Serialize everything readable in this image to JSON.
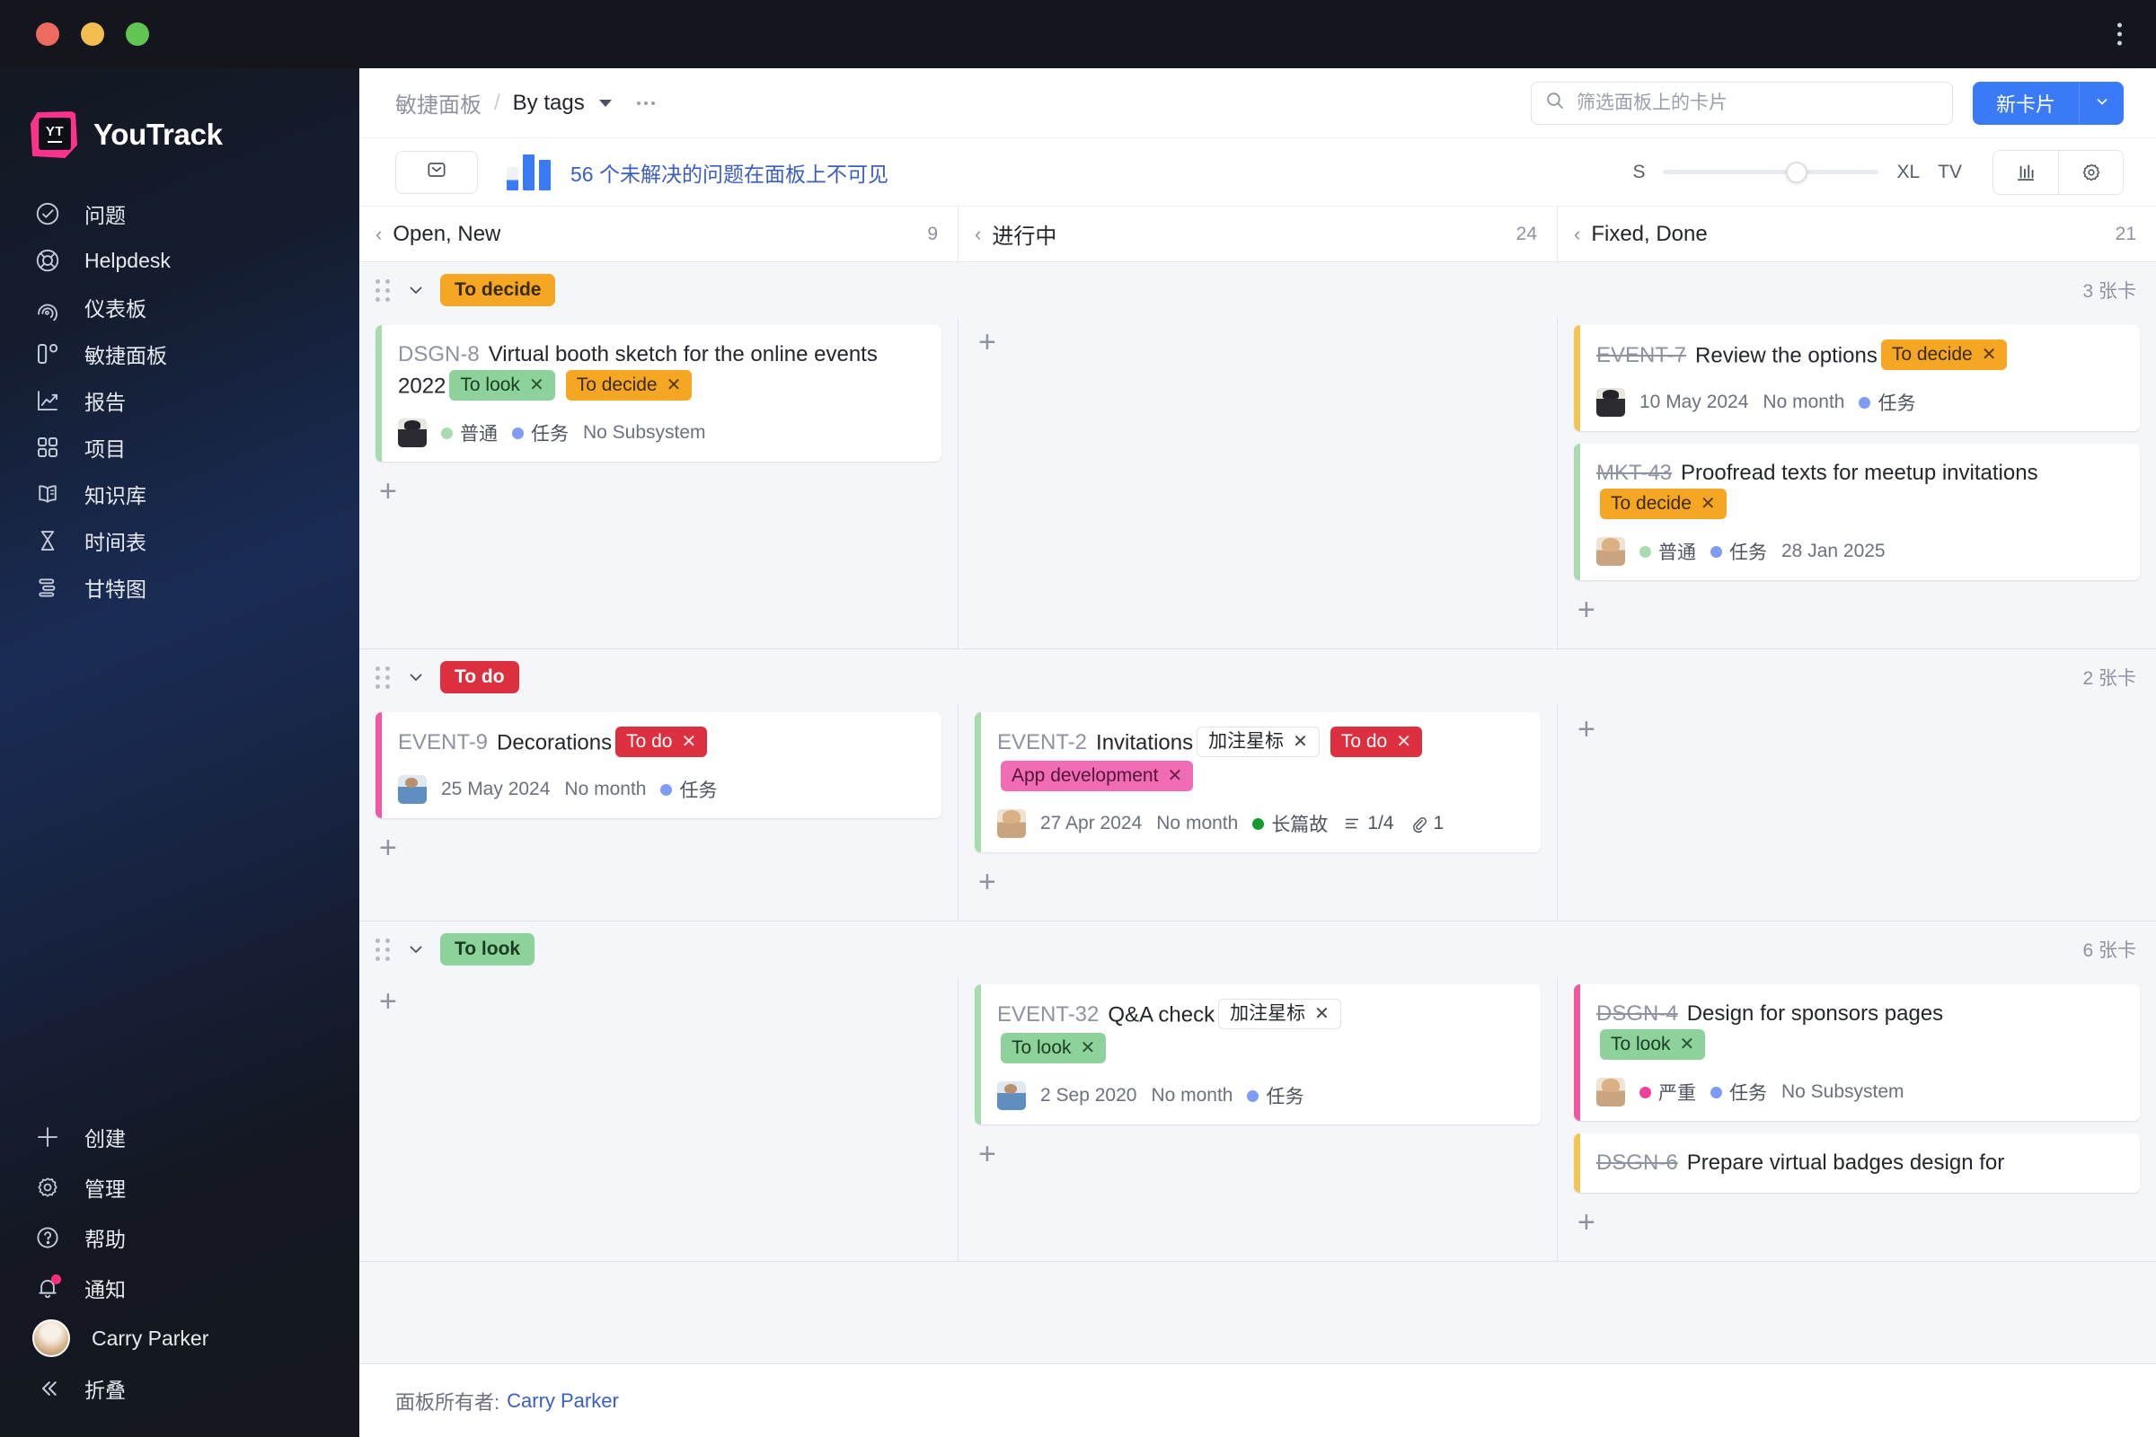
{
  "window": {
    "controls": [
      "close",
      "minimize",
      "maximize"
    ],
    "menu_icon": "kebab-vertical-icon"
  },
  "sidebar": {
    "brand": "YouTrack",
    "items": [
      {
        "label": "问题",
        "icon": "check-circle-icon"
      },
      {
        "label": "Helpdesk",
        "icon": "lifebuoy-icon"
      },
      {
        "label": "仪表板",
        "icon": "dashboard-icon"
      },
      {
        "label": "敏捷面板",
        "icon": "agile-board-icon"
      },
      {
        "label": "报告",
        "icon": "chart-line-icon"
      },
      {
        "label": "项目",
        "icon": "grid-icon"
      },
      {
        "label": "知识库",
        "icon": "book-icon"
      },
      {
        "label": "时间表",
        "icon": "hourglass-icon"
      },
      {
        "label": "甘特图",
        "icon": "gantt-icon"
      }
    ],
    "bottom_items": [
      {
        "label": "创建",
        "icon": "plus-icon"
      },
      {
        "label": "管理",
        "icon": "gear-icon"
      },
      {
        "label": "帮助",
        "icon": "question-circle-icon"
      },
      {
        "label": "通知",
        "icon": "bell-icon",
        "has_badge": true
      }
    ],
    "user": "Carry Parker",
    "collapse": {
      "label": "折叠",
      "icon": "chevron-double-left-icon"
    }
  },
  "topbar": {
    "breadcrumb_root": "敏捷面板",
    "breadcrumb_sep": "/",
    "breadcrumb_current": "By tags",
    "more_icon": "ellipsis-icon",
    "search": {
      "placeholder": "筛选面板上的卡片",
      "value": "",
      "icon": "search-icon"
    },
    "new_card_label": "新卡片",
    "new_card_dropdown_icon": "chevron-down-icon"
  },
  "subbar": {
    "inbox_icon": "inbox-icon",
    "chart_icon": "bar-chart-icon",
    "hidden_issues_text": "56 个未解决的问题在面板上不可见",
    "size_min": "S",
    "size_max": "XL",
    "tv_label": "TV",
    "slider_value": 62,
    "stats_icon": "chart-bars-icon",
    "settings_icon": "gear-icon"
  },
  "board": {
    "columns": [
      {
        "title": "Open, New",
        "count": "9"
      },
      {
        "title": "进行中",
        "count": "24"
      },
      {
        "title": "Fixed, Done",
        "count": "21"
      }
    ],
    "swimlanes": [
      {
        "tag": "To decide",
        "tag_bg": "#f5a623",
        "tag_fg": "#3a2a00",
        "count": "3 张卡",
        "cells": [
          {
            "cards": [
              {
                "id": "DSGN-8",
                "resolved": false,
                "title": "Virtual booth sketch for the online events 2022",
                "accent": "#a8dcb0",
                "tags": [
                  {
                    "label": "To look",
                    "bg": "#8ed29b",
                    "fg": "#183d22"
                  },
                  {
                    "label": "To decide",
                    "bg": "#f5a623",
                    "fg": "#3a2a00"
                  }
                ],
                "avatar": "man",
                "meta": [
                  {
                    "type": "chip",
                    "label": "普通",
                    "color": "#a8dcb0"
                  },
                  {
                    "type": "chip",
                    "label": "任务",
                    "color": "#7e9cf5"
                  },
                  {
                    "type": "text",
                    "label": "No Subsystem"
                  }
                ]
              }
            ],
            "add_label": "+"
          },
          {
            "cards": [],
            "add_label": "+"
          },
          {
            "cards": [
              {
                "id": "EVENT-7",
                "resolved": true,
                "title": "Review the options",
                "accent": "#f5c451",
                "tags": [
                  {
                    "label": "To decide",
                    "bg": "#f5a623",
                    "fg": "#3a2a00"
                  }
                ],
                "avatar": "man",
                "meta": [
                  {
                    "type": "text",
                    "label": "10 May 2024"
                  },
                  {
                    "type": "text",
                    "label": "No month"
                  },
                  {
                    "type": "chip",
                    "label": "任务",
                    "color": "#7e9cf5"
                  }
                ]
              },
              {
                "id": "MKT-43",
                "resolved": true,
                "title": "Proofread texts for meetup invitations",
                "accent": "#a8dcb0",
                "tags": [
                  {
                    "label": "To decide",
                    "bg": "#f5a623",
                    "fg": "#3a2a00"
                  }
                ],
                "avatar": "woman",
                "meta": [
                  {
                    "type": "chip",
                    "label": "普通",
                    "color": "#a8dcb0"
                  },
                  {
                    "type": "chip",
                    "label": "任务",
                    "color": "#7e9cf5"
                  },
                  {
                    "type": "text",
                    "label": "28 Jan 2025"
                  }
                ]
              }
            ],
            "add_label": "+"
          }
        ]
      },
      {
        "tag": "To do",
        "tag_bg": "#dc2f3f",
        "tag_fg": "#ffffff",
        "count": "2 张卡",
        "cells": [
          {
            "cards": [
              {
                "id": "EVENT-9",
                "resolved": false,
                "title": "Decorations",
                "accent": "#f2579f",
                "tags": [
                  {
                    "label": "To do",
                    "bg": "#dc2f3f",
                    "fg": "#ffffff"
                  }
                ],
                "avatar": "medic",
                "meta": [
                  {
                    "type": "text",
                    "label": "25 May 2024"
                  },
                  {
                    "type": "text",
                    "label": "No month"
                  },
                  {
                    "type": "chip",
                    "label": "任务",
                    "color": "#7e9cf5"
                  }
                ]
              }
            ],
            "add_label": "+"
          },
          {
            "cards": [
              {
                "id": "EVENT-2",
                "resolved": false,
                "title": "Invitations",
                "accent": "#a8dcb0",
                "tags": [
                  {
                    "label": "加注星标",
                    "bg": "#ffffff",
                    "fg": "#23262d",
                    "outlined": true
                  },
                  {
                    "label": "To do",
                    "bg": "#dc2f3f",
                    "fg": "#ffffff"
                  },
                  {
                    "label": "App development",
                    "bg": "#f06cb4",
                    "fg": "#54143a",
                    "newline": true
                  }
                ],
                "avatar": "woman",
                "meta": [
                  {
                    "type": "text",
                    "label": "27 Apr 2024"
                  },
                  {
                    "type": "text",
                    "label": "No month"
                  },
                  {
                    "type": "chip",
                    "label": "长篇故",
                    "color": "#149b2f"
                  },
                  {
                    "type": "checklist",
                    "label": "1/4",
                    "icon": "checklist-icon"
                  },
                  {
                    "type": "attachment",
                    "label": "1",
                    "icon": "paperclip-icon"
                  }
                ]
              }
            ],
            "add_label": "+"
          },
          {
            "cards": [],
            "add_label": "+"
          }
        ]
      },
      {
        "tag": "To look",
        "tag_bg": "#8ed29b",
        "tag_fg": "#183d22",
        "count": "6 张卡",
        "cells": [
          {
            "cards": [],
            "add_label": "+"
          },
          {
            "cards": [
              {
                "id": "EVENT-32",
                "resolved": false,
                "title": "Q&A check",
                "accent": "#a8dcb0",
                "tags": [
                  {
                    "label": "加注星标",
                    "bg": "#ffffff",
                    "fg": "#23262d",
                    "outlined": true
                  },
                  {
                    "label": "To look",
                    "bg": "#8ed29b",
                    "fg": "#183d22",
                    "newline": true
                  }
                ],
                "avatar": "medic",
                "meta": [
                  {
                    "type": "text",
                    "label": "2 Sep 2020"
                  },
                  {
                    "type": "text",
                    "label": "No month"
                  },
                  {
                    "type": "chip",
                    "label": "任务",
                    "color": "#7e9cf5"
                  }
                ]
              }
            ],
            "add_label": "+"
          },
          {
            "cards": [
              {
                "id": "DSGN-4",
                "resolved": true,
                "title": "Design for sponsors pages",
                "accent": "#f2579f",
                "tags": [
                  {
                    "label": "To look",
                    "bg": "#8ed29b",
                    "fg": "#183d22",
                    "newline": true
                  }
                ],
                "avatar": "woman",
                "meta": [
                  {
                    "type": "chip",
                    "label": "严重",
                    "color": "#f0409c"
                  },
                  {
                    "type": "chip",
                    "label": "任务",
                    "color": "#7e9cf5"
                  },
                  {
                    "type": "text",
                    "label": "No Subsystem"
                  }
                ]
              },
              {
                "id": "DSGN-6",
                "resolved": true,
                "title": "Prepare virtual badges design for",
                "accent": "#f5c451",
                "tags": [],
                "avatar": null,
                "meta": []
              }
            ],
            "add_label": "+"
          }
        ]
      }
    ]
  },
  "footer": {
    "owner_label": "面板所有者:",
    "owner_name": "Carry Parker"
  }
}
